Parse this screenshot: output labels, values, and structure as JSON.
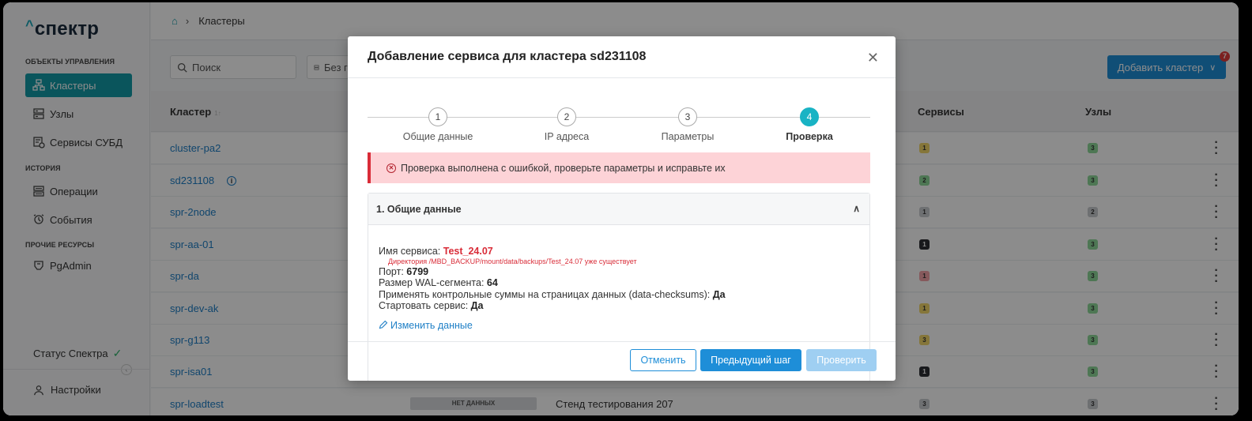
{
  "app": {
    "logo_caret": "^",
    "logo_text": "спектр"
  },
  "sidebar": {
    "section_objects": "ОБЪЕКТЫ УПРАВЛЕНИЯ",
    "section_history": "ИСТОРИЯ",
    "section_other": "ПРОЧИЕ РЕСУРСЫ",
    "items": [
      {
        "label": "Кластеры",
        "icon": "cluster-icon",
        "active": true
      },
      {
        "label": "Узлы",
        "icon": "server-icon"
      },
      {
        "label": "Сервисы СУБД",
        "icon": "db-service-icon"
      },
      {
        "label": "Операции",
        "icon": "operations-icon"
      },
      {
        "label": "События",
        "icon": "events-icon"
      },
      {
        "label": "PgAdmin",
        "icon": "pgadmin-icon"
      }
    ],
    "status_label": "Статус Спектра",
    "settings_label": "Настройки"
  },
  "breadcrumb": {
    "current": "Кластеры"
  },
  "toolbar": {
    "search_placeholder": "Поиск",
    "filter_label": "Без гр",
    "add_cluster_label": "Добавить кластер",
    "notification_count": "7"
  },
  "table": {
    "headers": {
      "cluster": "Кластер",
      "sort_glyph": "1↑",
      "services": "Сервисы",
      "nodes": "Узлы"
    },
    "rows": [
      {
        "name": "cluster-pa2",
        "services": "1",
        "services_color": "#f3d86b",
        "nodes": "3",
        "nodes_color": "#8fd99a"
      },
      {
        "name": "sd231108",
        "info": true,
        "services": "2",
        "services_color": "#8fd99a",
        "nodes": "3",
        "nodes_color": "#8fd99a"
      },
      {
        "name": "spr-2node",
        "services": "1",
        "services_color": "#c9ccd0",
        "nodes": "2",
        "nodes_color": "#c9ccd0"
      },
      {
        "name": "spr-aa-01",
        "services": "1",
        "services_color": "#2d2f33",
        "nodes": "3",
        "nodes_color": "#8fd99a"
      },
      {
        "name": "spr-da",
        "services": "1",
        "services_color": "#f5a3a8",
        "nodes": "3",
        "nodes_color": "#8fd99a"
      },
      {
        "name": "spr-dev-ak",
        "services": "1",
        "services_color": "#f3d86b",
        "nodes": "3",
        "nodes_color": "#8fd99a"
      },
      {
        "name": "spr-g113",
        "services": "3",
        "services_color": "#f3d86b",
        "nodes": "3",
        "nodes_color": "#8fd99a"
      },
      {
        "name": "spr-isa01",
        "services": "1",
        "services_color": "#2d2f33",
        "nodes": "3",
        "nodes_color": "#8fd99a"
      },
      {
        "name": "spr-loadtest",
        "status": "НЕТ ДАННЫХ",
        "description": "Стенд тестирования 207",
        "services": "3",
        "services_color": "#c9ccd0",
        "nodes": "3",
        "nodes_color": "#c9ccd0"
      }
    ]
  },
  "modal": {
    "title": "Добавление сервиса для кластера sd231108",
    "steps": [
      {
        "num": "1",
        "label": "Общие данные"
      },
      {
        "num": "2",
        "label": "IP адреса"
      },
      {
        "num": "3",
        "label": "Параметры"
      },
      {
        "num": "4",
        "label": "Проверка",
        "active": true
      }
    ],
    "alert_text": "Проверка выполнена с ошибкой, проверьте параметры и исправьте их",
    "section_title": "1. Общие данные",
    "service_name_label": "Имя сервиса: ",
    "service_name_value": "Test_24.07",
    "service_name_error": "Директория /MBD_BACKUP/mount/data/backups/Test_24.07 уже существует",
    "port_label": "Порт: ",
    "port_value": "6799",
    "wal_label": "Размер WAL-сегмента: ",
    "wal_value": "64",
    "checksums_label": "Применять контрольные суммы на страницах данных (data-checksums): ",
    "checksums_value": "Да",
    "start_label": "Стартовать сервис: ",
    "start_value": "Да",
    "edit_link": "Изменить данные",
    "buttons": {
      "cancel": "Отменить",
      "prev": "Предыдущий шаг",
      "check": "Проверить"
    }
  },
  "colors": {
    "accent": "#139ba8",
    "primary": "#1e8ed8",
    "error": "#d92c38"
  }
}
